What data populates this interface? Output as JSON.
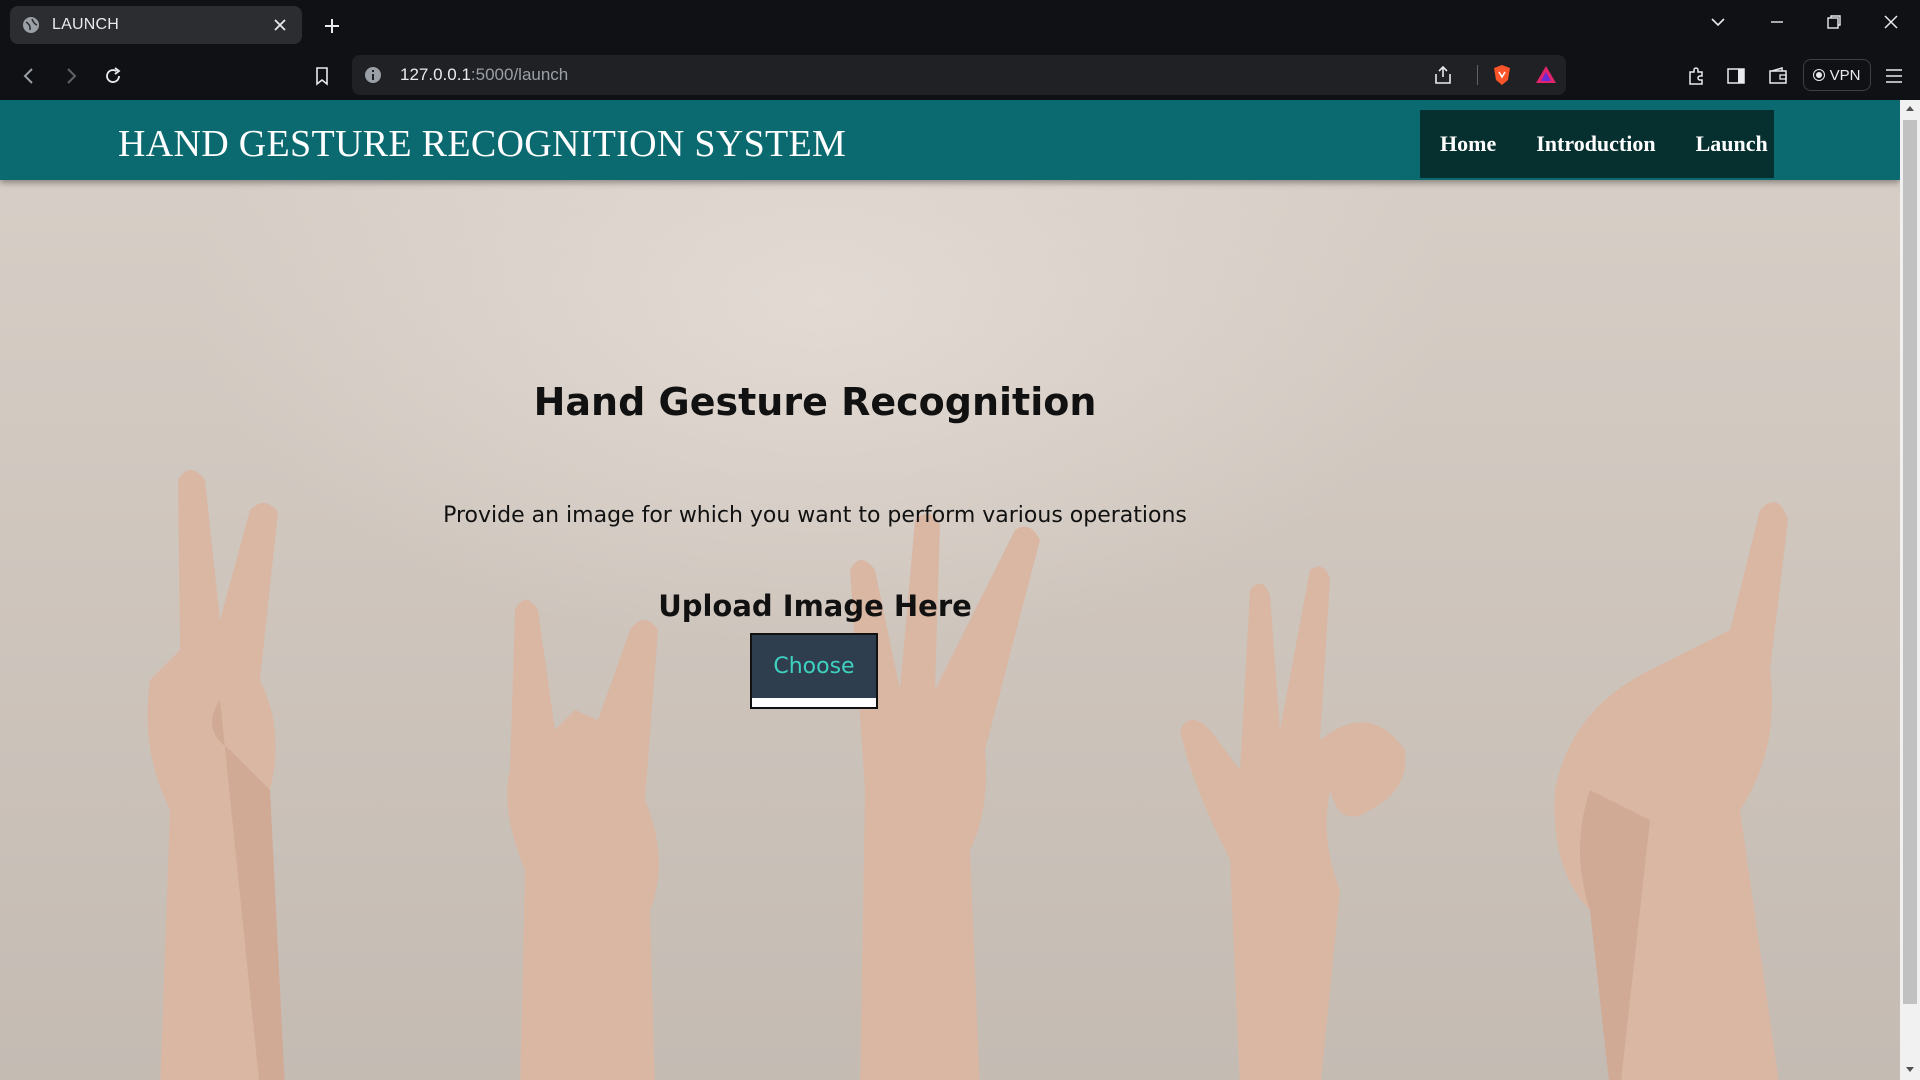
{
  "browser": {
    "tab_title": "LAUNCH",
    "url_host": "127.0.0.1",
    "url_rest": ":5000/launch",
    "vpn_label": "VPN"
  },
  "navbar": {
    "brand": "HAND GESTURE RECOGNITION SYSTEM",
    "links": [
      "Home",
      "Introduction",
      "Launch"
    ],
    "bg_color": "#0b6a70",
    "menu_bg_color": "#06302f"
  },
  "main": {
    "title": "Hand Gesture Recognition",
    "description": "Provide an image for which you want to perform various operations",
    "upload_label": "Upload Image Here",
    "choose_label": "Choose",
    "button_color": "#2f3e4f",
    "button_text_color": "#3fd1c0"
  }
}
